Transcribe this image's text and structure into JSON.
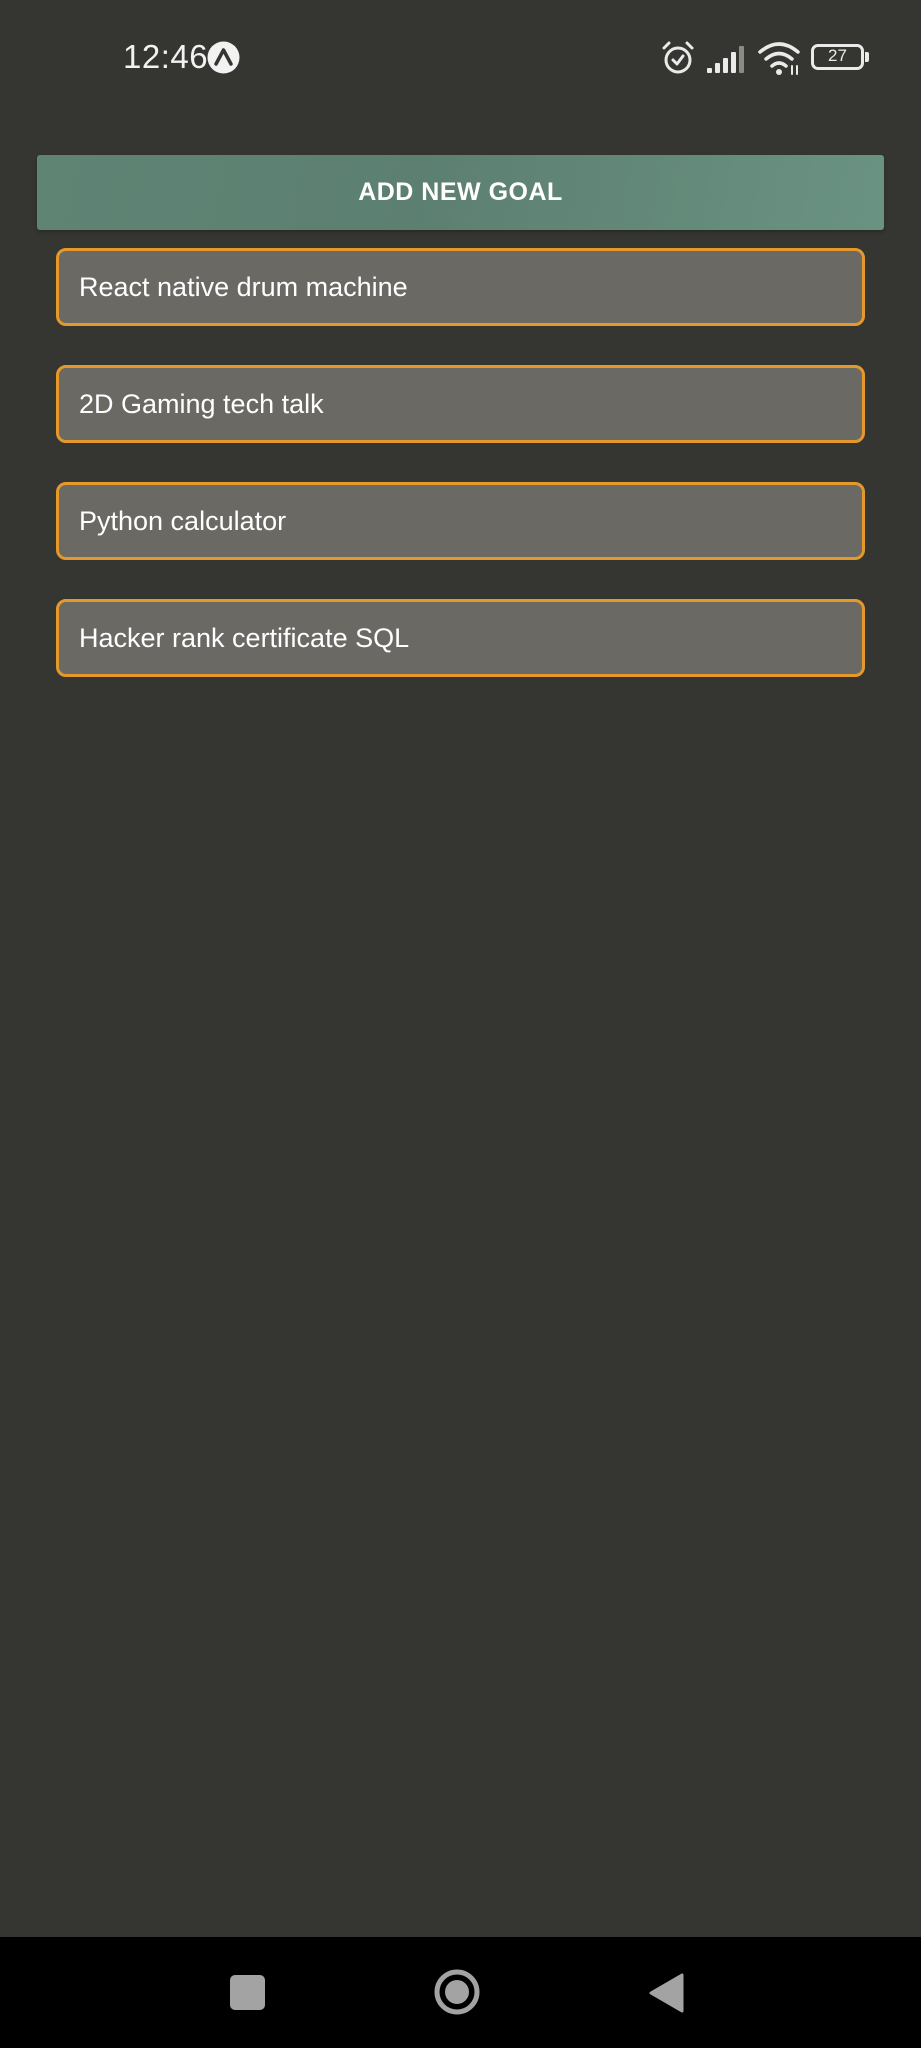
{
  "status_bar": {
    "time": "12:46",
    "battery_level": "27",
    "icons": [
      "expo-icon",
      "alarm-icon",
      "signal-icon",
      "wifi-icon",
      "battery-icon"
    ]
  },
  "actions": {
    "add_goal_label": "ADD NEW GOAL"
  },
  "goals": [
    {
      "text": "React native drum machine"
    },
    {
      "text": "2D Gaming tech talk"
    },
    {
      "text": "Python calculator"
    },
    {
      "text": "Hacker rank certificate SQL"
    }
  ],
  "navigation": {
    "icons": [
      "recents-icon",
      "home-icon",
      "back-icon"
    ]
  },
  "colors": {
    "background": "#353531",
    "button": "#5f8474",
    "goal_item": "#6a6964",
    "goal_border": "#e6992b",
    "nav_bar": "#000000"
  }
}
